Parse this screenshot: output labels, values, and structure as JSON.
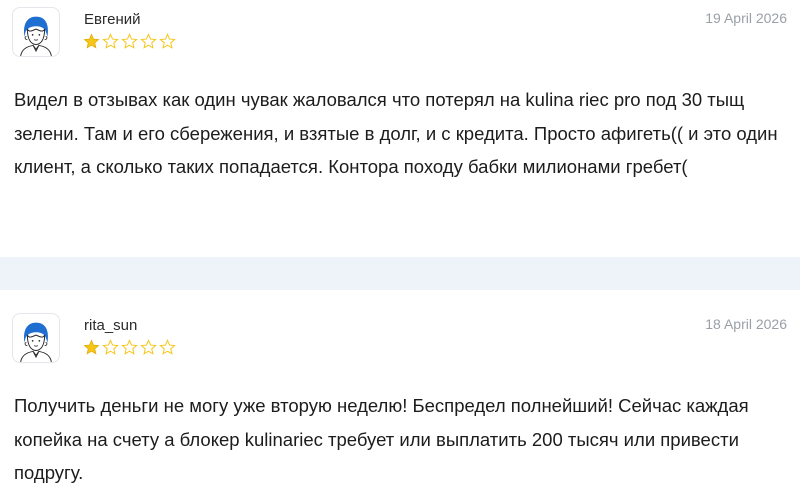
{
  "reviews": [
    {
      "author": "Евгений",
      "date": "19 April 2026",
      "rating": 1,
      "rating_max": 5,
      "text": "Видел в отзывах как один чувак жаловался что потерял на kulina riec pro под 30 тыщ зелени. Там и его сбережения, и взятые в долг, и с кредита. Просто афигеть(( и это один клиент, а сколько таких попадается. Контора походу бабки милионами гребет("
    },
    {
      "author": "rita_sun",
      "date": "18 April 2026",
      "rating": 1,
      "rating_max": 5,
      "text": "Получить деньги не могу уже вторую неделю! Беспредел полнейший! Сейчас каждая копейка на счету а блокер kulinariec требует или выплатить 200 тысяч или привести подругу."
    }
  ],
  "colors": {
    "star_filled": "#f5c518",
    "star_empty_outline": "#f5c518",
    "avatar_hair": "#1f6fd1",
    "divider_bg": "#eef3fa"
  },
  "icons": {
    "avatar": "user-avatar-icon",
    "star": "star-icon"
  }
}
